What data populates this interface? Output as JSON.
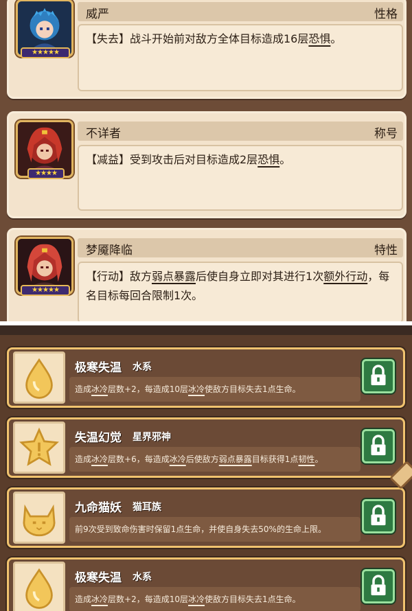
{
  "traits": [
    {
      "name": "威严",
      "type": "性格",
      "stars": "★★★★★",
      "desc_parts": [
        {
          "text": "【失去】战斗开始前对敌方全体目标造成16层",
          "underline": false
        },
        {
          "text": "恐惧",
          "underline": true
        },
        {
          "text": "。",
          "underline": false
        }
      ]
    },
    {
      "name": "不详者",
      "type": "称号",
      "stars": "★★★★",
      "desc_parts": [
        {
          "text": "【减益】受到攻击后对目标造成2层",
          "underline": false
        },
        {
          "text": "恐惧",
          "underline": true
        },
        {
          "text": "。",
          "underline": false
        }
      ]
    },
    {
      "name": "梦魇降临",
      "type": "特性",
      "stars": "★★★★★",
      "desc_parts": [
        {
          "text": "【行动】敌方",
          "underline": false
        },
        {
          "text": "弱点暴露",
          "underline": true
        },
        {
          "text": "后使自身立即对其进行1次",
          "underline": false
        },
        {
          "text": "额外行动",
          "underline": true
        },
        {
          "text": "，每名目标每回合限制1次。",
          "underline": false
        }
      ]
    }
  ],
  "skills": [
    {
      "name": "极寒失温",
      "tag": "水系",
      "icon": "water-drop-icon",
      "desc_parts": [
        {
          "text": "造成",
          "underline": false
        },
        {
          "text": "冰冷",
          "underline": true
        },
        {
          "text": "层数+2，每造成10层",
          "underline": false
        },
        {
          "text": "冰冷",
          "underline": true
        },
        {
          "text": "使敌方目标失去1点生命。",
          "underline": false
        }
      ]
    },
    {
      "name": "失温幻觉",
      "tag": "星界邪神",
      "icon": "star-icon",
      "desc_parts": [
        {
          "text": "造成",
          "underline": false
        },
        {
          "text": "冰冷",
          "underline": true
        },
        {
          "text": "层数+6，每造成",
          "underline": false
        },
        {
          "text": "冰冷",
          "underline": true
        },
        {
          "text": "后使敌方",
          "underline": false
        },
        {
          "text": "弱点暴露",
          "underline": true
        },
        {
          "text": "目标获得1点",
          "underline": false
        },
        {
          "text": "韧性",
          "underline": true
        },
        {
          "text": "。",
          "underline": false
        }
      ]
    },
    {
      "name": "九命猫妖",
      "tag": "猫耳族",
      "icon": "cat-head-icon",
      "desc_parts": [
        {
          "text": "前9次受到致命伤害时保留1点生命，并使自身失去50%的生命上限。",
          "underline": false
        }
      ]
    },
    {
      "name": "极寒失温",
      "tag": "水系",
      "icon": "water-drop-icon",
      "desc_parts": [
        {
          "text": "造成",
          "underline": false
        },
        {
          "text": "冰冷",
          "underline": true
        },
        {
          "text": "层数+2，每造成10层",
          "underline": false
        },
        {
          "text": "冰冷",
          "underline": true
        },
        {
          "text": "使敌方目标失去1点生命。",
          "underline": false
        }
      ]
    }
  ],
  "lock_icon": "lock-icon",
  "colors": {
    "card_bg": "#f3e3cc",
    "skill_border": "#f1c36f",
    "lock_green": "#2e7a42",
    "star_gold": "#ffd542"
  }
}
